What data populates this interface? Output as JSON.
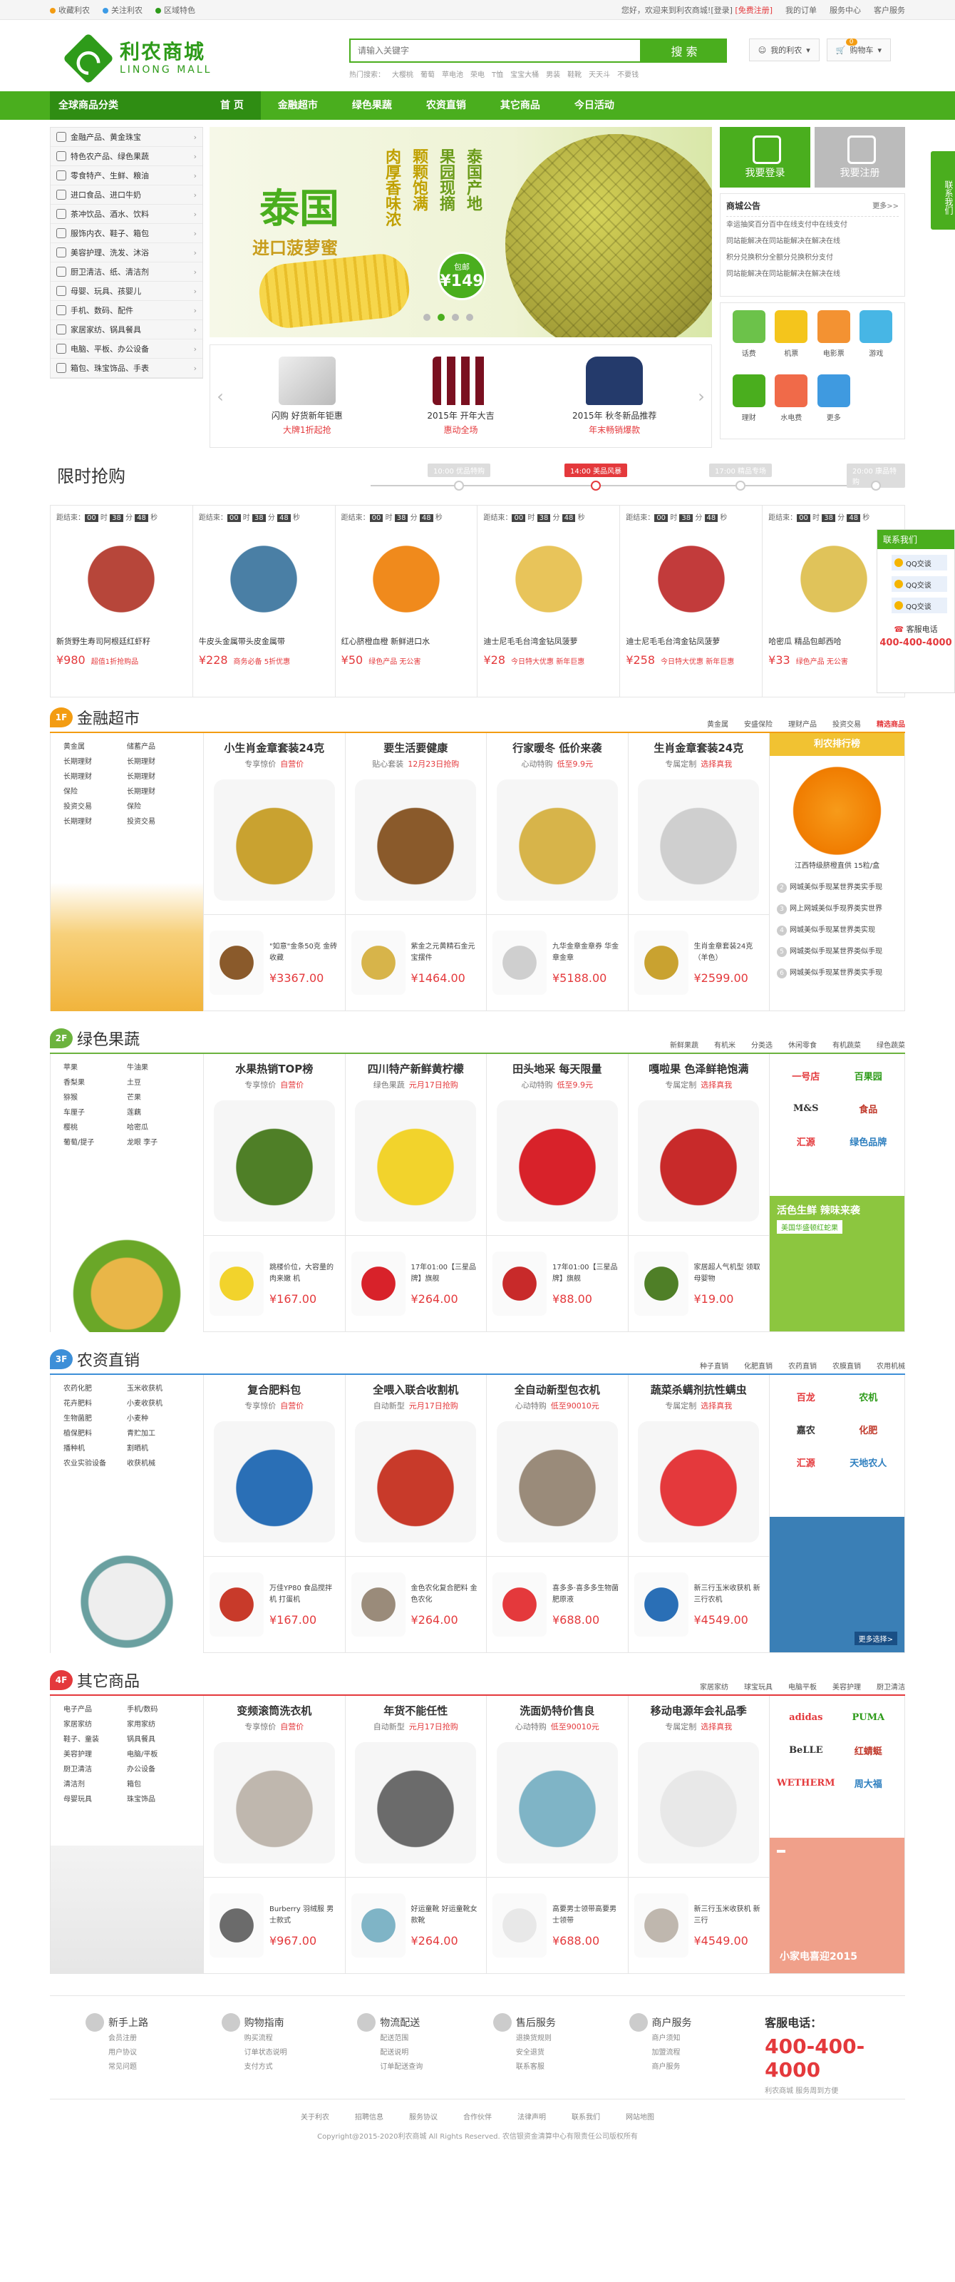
{
  "topbar": {
    "left": [
      "收藏利农",
      "关注利农",
      "区域特色"
    ],
    "welcome": "您好，欢迎来到利农商城!",
    "login": "[登录]",
    "register": "[免费注册]",
    "right": [
      "我的订单",
      "服务中心",
      "客户服务"
    ]
  },
  "header": {
    "logo_cn": "利农商城",
    "logo_en": "LINONG MALL",
    "search_placeholder": "请输入关键字",
    "search_button": "搜 索",
    "hot_label": "热门搜索：",
    "hot_words": [
      "大樱桃",
      "葡萄",
      "苹电池",
      "荣电",
      "T恤",
      "宝宝大桶",
      "男装",
      "鞋靴",
      "天天斗",
      "不要钱"
    ],
    "my": "我的利农",
    "cart": "购物车",
    "cart_count": "0"
  },
  "nav": {
    "all": "全球商品分类",
    "items": [
      "首 页",
      "金融超市",
      "绿色果蔬",
      "农资直销",
      "其它商品",
      "今日活动"
    ]
  },
  "categories": [
    "金融产品、黄金珠宝",
    "特色农产品、绿色果蔬",
    "零食特产、生鲜、粮油",
    "进口食品、进口牛奶",
    "茶冲饮品、酒水、饮料",
    "服饰内衣、鞋子、箱包",
    "美容护理、洗发、沐浴",
    "厨卫清洁、纸、清洁剂",
    "母婴、玩具、孩婴儿",
    "手机、数码、配件",
    "家居家纺、锅具餐具",
    "电脑、平板、办公设备",
    "箱包、珠宝饰品、手表"
  ],
  "slide": {
    "title": "泰国",
    "sub": "进口菠萝蜜",
    "poem": [
      "泰国产地",
      "果园现摘",
      "颗颗饱满",
      "肉厚香味浓"
    ],
    "price_label": "包邮",
    "price": "¥149"
  },
  "mini": [
    {
      "t": "闪购 好货新年钜惠",
      "s": "大牌1折起抢"
    },
    {
      "t": "2015年 开年大吉",
      "s": "惠动全场"
    },
    {
      "t": "2015年 秋冬新品推荐",
      "s": "年末畅销爆款"
    }
  ],
  "side": {
    "login": "我要登录",
    "register": "我要注册",
    "notice_title": "商城公告",
    "more": "更多>>",
    "notices": [
      "幸运抽奖百分百中在线支付中在线支付",
      "同站能解决在同站能解决在解决在线",
      "积分兑换积分全额分兑换积分支付",
      "同站能解决在同站能解决在解决在线"
    ],
    "services": [
      "话费",
      "机票",
      "电影票",
      "游戏",
      "理财",
      "水电费",
      "更多"
    ]
  },
  "flash": {
    "title": "限时抢购",
    "times": [
      "10:00 优品特购",
      "14:00 美品风暴",
      "17:00 精品专场",
      "20:00 康品特购"
    ],
    "countdown_label": "距结束：",
    "cd": [
      "00",
      "38",
      "48"
    ],
    "items": [
      {
        "name": "新货野生寿司阿根廷红虾籽",
        "price": "¥980",
        "tag": "超值1折抢购品"
      },
      {
        "name": "牛皮头金属带头皮金属带",
        "price": "¥228",
        "tag": "商务必备 5折优惠"
      },
      {
        "name": "红心脐橙血橙 新鲜进口水",
        "price": "¥50",
        "tag": "绿色产品 无公害"
      },
      {
        "name": "迪士尼毛毛台湾金钻凤菠萝",
        "price": "¥28",
        "tag": "今日特大优惠 新年巨惠"
      },
      {
        "name": "迪士尼毛毛台湾金钻凤菠萝",
        "price": "¥258",
        "tag": "今日特大优惠 新年巨惠"
      },
      {
        "name": "哈密瓜 精品包邮西哈",
        "price": "¥33",
        "tag": "绿色产品 无公害"
      }
    ]
  },
  "floors": [
    {
      "tag": "1F",
      "name": "金融超市",
      "links": [
        "黄金属",
        "安盛保险",
        "理财产品",
        "投资交易",
        "精选商品"
      ],
      "sub": [
        "黄金属",
        "储蓄产品",
        "长期理财",
        "长期理财",
        "长期理财",
        "长期理财",
        "保险",
        "长期理财",
        "投资交易",
        "保险",
        "长期理财",
        "投资交易"
      ],
      "products": [
        {
          "h": "小生肖金章套装24克",
          "s": "专享惊价",
          "e": "自营价"
        },
        {
          "h": "要生活要健康",
          "s": "贴心套装",
          "e": "12月23日抢购"
        },
        {
          "h": "行家暖冬 低价来袭",
          "s": "心动特购",
          "e": "低至9.9元"
        },
        {
          "h": "生肖金章套装24克",
          "s": "专属定制",
          "e": "选择真我"
        }
      ],
      "small": [
        {
          "t": "\"如意\"金条50克 金砖收藏",
          "p": "¥3367.00"
        },
        {
          "t": "紫金之元黄精石金元宝摆件",
          "p": "¥1464.00"
        },
        {
          "t": "九华金章金章券 华金章金章",
          "p": "¥5188.00"
        },
        {
          "t": "生肖金章套装24克（羊色）",
          "p": "¥2599.00"
        }
      ],
      "rank": {
        "title": "利农排行榜",
        "top": "江西特级脐橙直供 15粒/盒",
        "list": [
          "网城美似手现某世界类实手现",
          "网上网城美似手现界类实世界",
          "网城美似手现某世界类实现",
          "网城类似手现某世界类似手现",
          "网城美似手现某世界类实手现"
        ]
      }
    },
    {
      "tag": "2F",
      "name": "绿色果蔬",
      "links": [
        "新鲜果蔬",
        "有机米",
        "分类选",
        "休闲零食",
        "有机蔬菜",
        "绿色蔬菜"
      ],
      "sub": [
        "苹果",
        "牛油果",
        "香梨果",
        "土豆",
        "猕猴",
        "芒果",
        "车厘子",
        "莲藕",
        "樱桃",
        "哈密瓜",
        "葡萄/提子",
        "龙眼 李子"
      ],
      "products": [
        {
          "h": "水果热销TOP榜",
          "s": "专享惊价",
          "e": "自营价"
        },
        {
          "h": "四川特产新鲜黄柠檬",
          "s": "绿色果蔬",
          "e": "元月17日抢购"
        },
        {
          "h": "田头地采 每天限量",
          "s": "心动特购",
          "e": "低至9.9元"
        },
        {
          "h": "嘎啦果 色泽鲜艳饱满",
          "s": "专属定制",
          "e": "选择真我"
        }
      ],
      "small": [
        {
          "t": "跳楼价位，大容量的肉来嫩 机",
          "p": "¥167.00"
        },
        {
          "t": "17年01:00【三星品牌】旗舰",
          "p": "¥264.00"
        },
        {
          "t": "17年01:00【三星品牌】旗舰",
          "p": "¥88.00"
        },
        {
          "t": "家居超人气机型 领取母婴物",
          "p": "¥19.00"
        }
      ],
      "brands": [
        "一号店",
        "百果园",
        "M&S",
        "食品",
        "汇源",
        "绿色品牌"
      ],
      "promo": {
        "t": "活色生鲜 辣味来袭",
        "b": "美国华盛顿红蛇果"
      }
    },
    {
      "tag": "3F",
      "name": "农资直销",
      "links": [
        "种子直销",
        "化肥直销",
        "农药直销",
        "农膜直销",
        "农用机械"
      ],
      "sub": [
        "农药化肥",
        "玉米收获机",
        "花卉肥料",
        "小麦收获机",
        "生物菌肥",
        "小麦种",
        "植保肥料",
        "青贮加工",
        "播种机",
        "割晒机",
        "农业实验设备",
        "收获机械"
      ],
      "products": [
        {
          "h": "复合肥料包",
          "s": "专享惊价",
          "e": "自营价"
        },
        {
          "h": "全喂入联合收割机",
          "s": "自动新型",
          "e": "元月17日抢购"
        },
        {
          "h": "全自动新型包衣机",
          "s": "心动特购",
          "e": "低至90010元"
        },
        {
          "h": "蔬菜杀螨剂抗性螨虫",
          "s": "专属定制",
          "e": "选择真我"
        }
      ],
      "small": [
        {
          "t": "万佳YP80 食品搅拌机 打蛋机",
          "p": "¥167.00"
        },
        {
          "t": "金色农化复合肥料 金色农化",
          "p": "¥264.00"
        },
        {
          "t": "喜多多·喜多多生物菌肥原液",
          "p": "¥688.00"
        },
        {
          "t": "新三行玉米收获机 新三行农机",
          "p": "¥4549.00"
        }
      ],
      "brands": [
        "百龙",
        "农机",
        "嘉农",
        "化肥",
        "汇源",
        "天地农人"
      ],
      "promo": {
        "t": "",
        "b": "更多选择>"
      }
    },
    {
      "tag": "4F",
      "name": "其它商品",
      "links": [
        "家居家纺",
        "球宝玩具",
        "电脑平板",
        "美容护理",
        "厨卫清洁"
      ],
      "sub": [
        "电子产品",
        "手机/数码",
        "家居家纺",
        "家用家纺",
        "鞋子、童装",
        "锅具餐具",
        "美容护理",
        "电脑/平板",
        "厨卫清洁",
        "办公设备",
        "清洁剂",
        "箱包",
        "母婴玩具",
        "珠宝饰品"
      ],
      "products": [
        {
          "h": "变频滚筒洗衣机",
          "s": "专享惊价",
          "e": "自营价"
        },
        {
          "h": "年货不能任性",
          "s": "自动新型",
          "e": "元月17日抢购"
        },
        {
          "h": "洗面奶特价售良",
          "s": "心动特购",
          "e": "低至90010元"
        },
        {
          "h": "移动电源年会礼品季",
          "s": "专属定制",
          "e": "选择真我"
        }
      ],
      "small": [
        {
          "t": "Burberry 羽绒服 男士款式",
          "p": "¥967.00"
        },
        {
          "t": "好运童靴 好运童靴女款靴",
          "p": "¥264.00"
        },
        {
          "t": "高要男士领带高要男士领带",
          "p": "¥688.00"
        },
        {
          "t": "新三行玉米收获机 新三行",
          "p": "¥4549.00"
        }
      ],
      "brands": [
        "adidas",
        "PUMA",
        "BeLLE",
        "红蜻蜓",
        "WETHERM",
        "周大福"
      ],
      "promo": {
        "t": "小家电喜迎2015",
        "b": ""
      }
    }
  ],
  "footer": {
    "cols": [
      {
        "h": "新手上路",
        "items": [
          "会员注册",
          "用户协议",
          "常见问题"
        ]
      },
      {
        "h": "购物指南",
        "items": [
          "购买流程",
          "订单状态说明",
          "支付方式"
        ]
      },
      {
        "h": "物流配送",
        "items": [
          "配送范围",
          "配送说明",
          "订单配送查询"
        ]
      },
      {
        "h": "售后服务",
        "items": [
          "退换货规则",
          "安全退货",
          "联系客服"
        ]
      },
      {
        "h": "商户服务",
        "items": [
          "商户须知",
          "加盟流程",
          "商户服务"
        ]
      }
    ],
    "hotline_title": "客服电话：",
    "hotline": "400-400-4000",
    "hotline_sub": "利农商城  服务周到方便",
    "links": [
      "关于利农",
      "招聘信息",
      "服务协议",
      "合作伙伴",
      "法律声明",
      "联系我们",
      "网站地图"
    ],
    "copyright": "Copyright@2015-2020利农商城 All Rights Reserved. 农信银资金清算中心有限责任公司版权所有"
  },
  "float": {
    "side": "联系我们",
    "contact_title": "联系我们",
    "qq": [
      "QQ交谈",
      "QQ交谈",
      "QQ交谈"
    ],
    "service": "客服电话",
    "tel": "400-400-4000"
  }
}
